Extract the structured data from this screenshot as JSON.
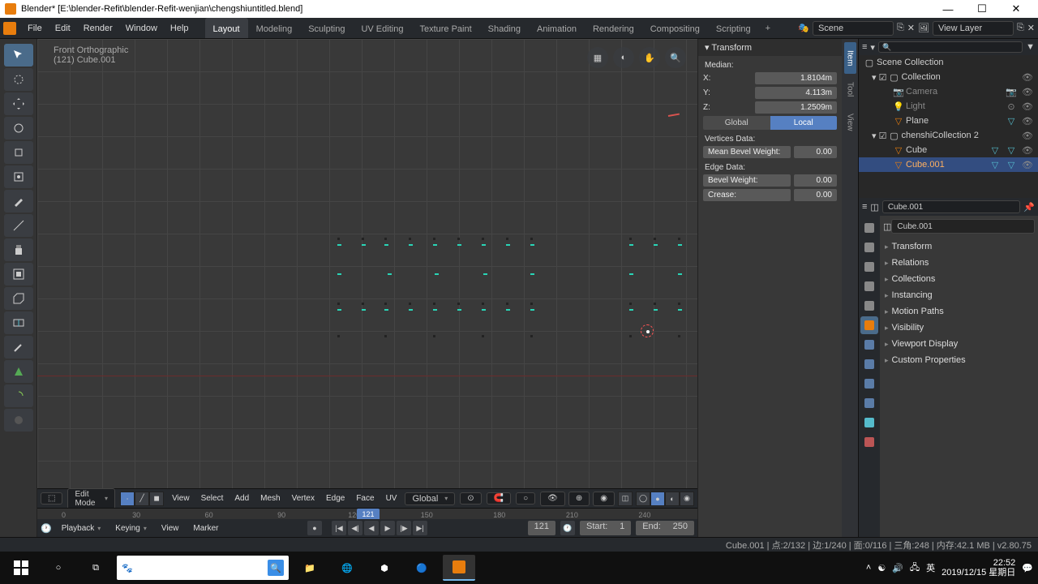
{
  "window": {
    "title": "Blender* [E:\\blender-Refit\\blender-Refit-wenjian\\chengshiuntitled.blend]"
  },
  "menu": {
    "file": "File",
    "edit": "Edit",
    "render": "Render",
    "window": "Window",
    "help": "Help"
  },
  "tabs": [
    "Layout",
    "Modeling",
    "Sculpting",
    "UV Editing",
    "Texture Paint",
    "Shading",
    "Animation",
    "Rendering",
    "Compositing",
    "Scripting"
  ],
  "scene": "Scene",
  "viewlayer": "View Layer",
  "viewport": {
    "view_name": "Front Orthographic",
    "object_line": "(121) Cube.001"
  },
  "npanel": {
    "tabs": [
      "Item",
      "Tool",
      "View"
    ],
    "transform": "Transform",
    "median": "Median:",
    "x": "X:",
    "xv": "1.8104m",
    "y": "Y:",
    "yv": "4.113m",
    "z": "Z:",
    "zv": "1.2509m",
    "global": "Global",
    "local": "Local",
    "vertdata": "Vertices Data:",
    "meanbevel": "Mean Bevel Weight:",
    "meanbevelv": "0.00",
    "edgedata": "Edge Data:",
    "bevelw": "Bevel Weight:",
    "bevelwv": "0.00",
    "crease": "Crease:",
    "creasev": "0.00"
  },
  "outliner": {
    "scene_collection": "Scene Collection",
    "collection": "Collection",
    "camera": "Camera",
    "light": "Light",
    "plane": "Plane",
    "chenshi": "chenshiCollection 2",
    "cube": "Cube",
    "cube001": "Cube.001"
  },
  "props": {
    "object": "Cube.001",
    "bc": "Cube.001",
    "cats": [
      "Transform",
      "Relations",
      "Collections",
      "Instancing",
      "Motion Paths",
      "Visibility",
      "Viewport Display",
      "Custom Properties"
    ]
  },
  "vpfooter": {
    "mode": "Edit Mode",
    "view": "View",
    "select": "Select",
    "add": "Add",
    "mesh": "Mesh",
    "vertex": "Vertex",
    "edge": "Edge",
    "face": "Face",
    "uv": "UV",
    "orient": "Global"
  },
  "timeline": {
    "ticks": [
      "0",
      "30",
      "60",
      "90",
      "120",
      "150",
      "180",
      "210",
      "240"
    ],
    "frame": "121",
    "playback": "Playback",
    "keying": "Keying",
    "view": "View",
    "marker": "Marker",
    "curframe": "121",
    "start_l": "Start:",
    "start_v": "1",
    "end_l": "End:",
    "end_v": "250"
  },
  "status": "Cube.001 | 点:2/132 | 边:1/240 | 面:0/116 | 三角:248 | 内存:42.1 MB | v2.80.75",
  "tray": {
    "time": "22:52",
    "date": "2019/12/15 星期日"
  }
}
